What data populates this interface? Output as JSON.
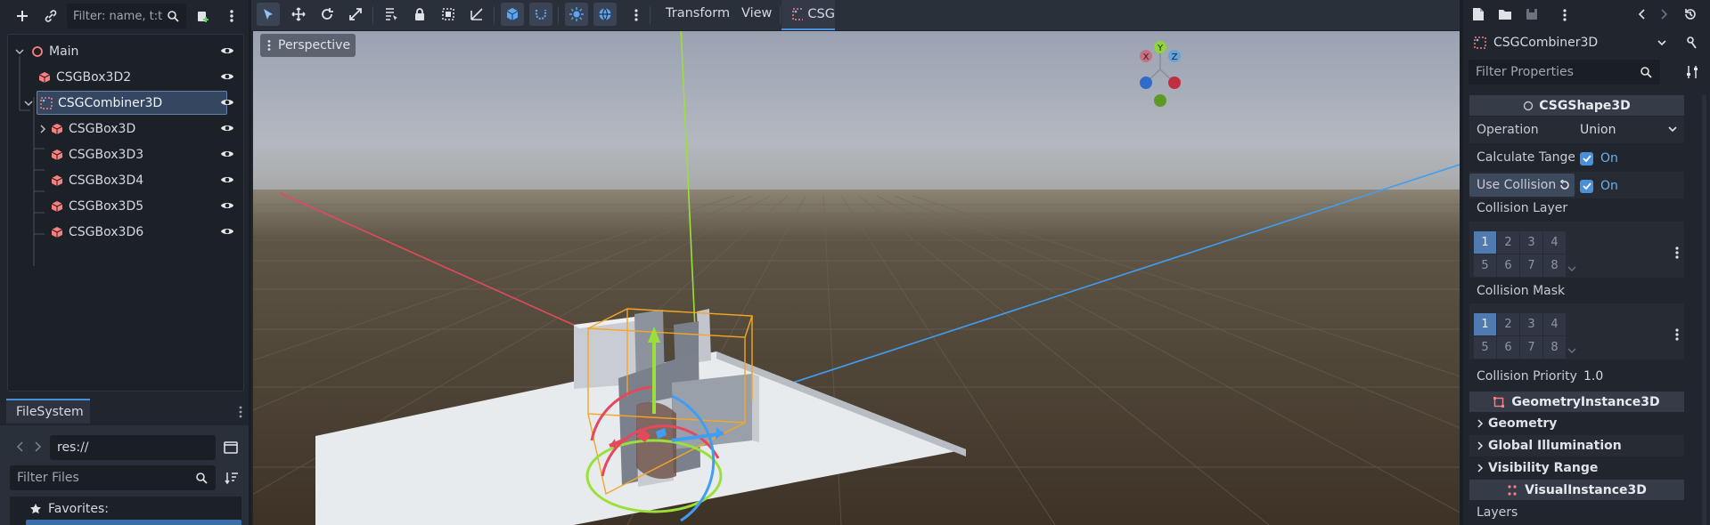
{
  "scene_dock": {
    "filter_placeholder": "Filter: name, t:t",
    "tree": [
      {
        "label": "Main",
        "icon": "node3d-icon",
        "depth": 0
      },
      {
        "label": "CSGBox3D2",
        "icon": "csgbox-icon",
        "depth": 1
      },
      {
        "label": "CSGCombiner3D",
        "icon": "csgcombiner-icon",
        "depth": 1,
        "selected": true
      },
      {
        "label": "CSGBox3D",
        "icon": "csgbox-icon",
        "depth": 2,
        "collapsed": true
      },
      {
        "label": "CSGBox3D3",
        "icon": "csgbox-icon",
        "depth": 2
      },
      {
        "label": "CSGBox3D4",
        "icon": "csgbox-icon",
        "depth": 2
      },
      {
        "label": "CSGBox3D5",
        "icon": "csgbox-icon",
        "depth": 2
      },
      {
        "label": "CSGBox3D6",
        "icon": "csgbox-icon",
        "depth": 2
      }
    ]
  },
  "filesystem": {
    "tab": "FileSystem",
    "path": "res://",
    "filter_placeholder": "Filter Files",
    "favorites": "Favorites:"
  },
  "viewport": {
    "menus": {
      "transform": "Transform",
      "view": "View",
      "csg": "CSG"
    },
    "perspective": "Perspective",
    "gizmo": {
      "y": "Y",
      "x": "X",
      "z": "Z"
    }
  },
  "inspector": {
    "node_name": "CSGCombiner3D",
    "filter_placeholder": "Filter Properties",
    "sections": {
      "csgshape": "CSGShape3D",
      "geometry_instance": "GeometryInstance3D",
      "visual_instance": "VisualInstance3D"
    },
    "props": {
      "operation": "Operation",
      "operation_value": "Union",
      "calc_tangents": "Calculate Tange",
      "calc_tangents_value": "On",
      "use_collision": "Use Collision",
      "use_collision_value": "On",
      "collision_layer": "Collision Layer",
      "collision_mask": "Collision Mask",
      "collision_priority": "Collision Priority",
      "collision_priority_value": "1.0"
    },
    "bits": [
      "1",
      "2",
      "3",
      "4",
      "5",
      "6",
      "7",
      "8"
    ],
    "groups": {
      "geometry": "Geometry",
      "global_illumination": "Global Illumination",
      "visibility_range": "Visibility Range"
    },
    "layers": "Layers"
  },
  "colors": {
    "accent": "#4a90d9",
    "x_axis": "#e3495d",
    "y_axis": "#8fd43a",
    "z_axis": "#3f9ef3",
    "selection": "#f5a623"
  }
}
